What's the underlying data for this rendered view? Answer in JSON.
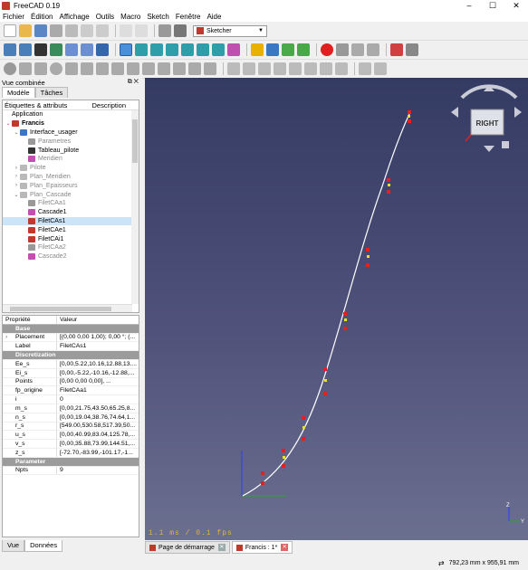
{
  "window": {
    "title": "FreeCAD 0.19",
    "controls": [
      "–",
      "☐",
      "✕"
    ]
  },
  "menu": [
    "Fichier",
    "Édition",
    "Affichage",
    "Outils",
    "Macro",
    "Sketch",
    "Fenêtre",
    "Aide"
  ],
  "toolbar": {
    "workbench": "Sketcher"
  },
  "combo": {
    "title": "Vue combinée",
    "tabs": [
      "Modèle",
      "Tâches"
    ],
    "tree_headers": [
      "Étiquettes & attributs",
      "Description"
    ],
    "tree": [
      {
        "label": "Application",
        "indent": 0,
        "arrow": "",
        "color": "",
        "gray": false,
        "sel": false
      },
      {
        "label": "Francis",
        "indent": 0,
        "arrow": "⌄",
        "color": "#c0392b",
        "gray": false,
        "sel": false,
        "bold": true
      },
      {
        "label": "Interface_usager",
        "indent": 1,
        "arrow": "⌄",
        "color": "#3b78c4",
        "gray": false,
        "sel": false
      },
      {
        "label": "Parametres",
        "indent": 2,
        "arrow": "",
        "color": "#999",
        "gray": true,
        "sel": false
      },
      {
        "label": "Tableau_pilote",
        "indent": 2,
        "arrow": "",
        "color": "#333",
        "gray": false,
        "sel": false
      },
      {
        "label": "Meridien",
        "indent": 2,
        "arrow": "",
        "color": "#c44fb0",
        "gray": true,
        "sel": false
      },
      {
        "label": "Pilote",
        "indent": 1,
        "arrow": "›",
        "color": "#b9b9b9",
        "gray": true,
        "sel": false
      },
      {
        "label": "Plan_Meridien",
        "indent": 1,
        "arrow": "›",
        "color": "#b9b9b9",
        "gray": true,
        "sel": false
      },
      {
        "label": "Plan_Epaisseurs",
        "indent": 1,
        "arrow": "›",
        "color": "#b9b9b9",
        "gray": true,
        "sel": false
      },
      {
        "label": "Plan_Cascade",
        "indent": 1,
        "arrow": "⌄",
        "color": "#b9b9b9",
        "gray": true,
        "sel": false
      },
      {
        "label": "FiletCAa1",
        "indent": 2,
        "arrow": "",
        "color": "#999",
        "gray": true,
        "sel": false
      },
      {
        "label": "Cascade1",
        "indent": 2,
        "arrow": "",
        "color": "#c44fb0",
        "gray": false,
        "sel": false
      },
      {
        "label": "FiletCAs1",
        "indent": 2,
        "arrow": "",
        "color": "#c0392b",
        "gray": false,
        "sel": true
      },
      {
        "label": "FiletCAe1",
        "indent": 2,
        "arrow": "",
        "color": "#c0392b",
        "gray": false,
        "sel": false
      },
      {
        "label": "FiletCAi1",
        "indent": 2,
        "arrow": "",
        "color": "#c0392b",
        "gray": false,
        "sel": false
      },
      {
        "label": "FiletCAa2",
        "indent": 2,
        "arrow": "",
        "color": "#999",
        "gray": true,
        "sel": false
      },
      {
        "label": "Cascade2",
        "indent": 2,
        "arrow": "",
        "color": "#c44fb0",
        "gray": true,
        "sel": false
      }
    ],
    "props_headers": [
      "Propriété",
      "Valeur"
    ],
    "props": [
      {
        "type": "group",
        "k": "Base",
        "v": ""
      },
      {
        "type": "row",
        "k": "Placement",
        "v": "[(0,00 0,00 1,00); 0,00 °; (...",
        "arrow": true
      },
      {
        "type": "row",
        "k": "Label",
        "v": "FiletCAs1"
      },
      {
        "type": "group",
        "k": "Discretization",
        "v": ""
      },
      {
        "type": "row",
        "k": "Ee_s",
        "v": "[0,00,5.22,10.16,12.88,13...."
      },
      {
        "type": "row",
        "k": "Ei_s",
        "v": "[0,00,-5.22,-10.16,-12.88,..."
      },
      {
        "type": "row",
        "k": "Points",
        "v": "[0,00 0,00 0,00], ..."
      },
      {
        "type": "row",
        "k": "fp_origine",
        "v": "FiletCAa1"
      },
      {
        "type": "row",
        "k": "i",
        "v": "0"
      },
      {
        "type": "row",
        "k": "m_s",
        "v": "[0,00,21.75,43.50,65.25,8..."
      },
      {
        "type": "row",
        "k": "n_s",
        "v": "[0,00,19.04,38.76,74.64,1..."
      },
      {
        "type": "row",
        "k": "r_s",
        "v": "[549.00,530.58,517.39,50..."
      },
      {
        "type": "row",
        "k": "u_s",
        "v": "[0,00,40.99,83.04,125.78,..."
      },
      {
        "type": "row",
        "k": "v_s",
        "v": "[0,00,35.88,73.99,144.51,..."
      },
      {
        "type": "row",
        "k": "z_s",
        "v": "[-72.70,-83.99,-101.17,-1..."
      },
      {
        "type": "group",
        "k": "Parameter",
        "v": ""
      },
      {
        "type": "row",
        "k": "Npts",
        "v": "9"
      }
    ],
    "bottom_tabs": [
      "Vue",
      "Données"
    ]
  },
  "viewport": {
    "fps": "1.1 ms / 0.1 fps",
    "nav_label": "RIGHT",
    "axis_z": "Z",
    "axis_y": "Y"
  },
  "doc_tabs": [
    {
      "label": "Page de démarrage",
      "active": false
    },
    {
      "label": "Francis : 1*",
      "active": true
    }
  ],
  "status": {
    "dimensions": "792,23 mm x 955,91 mm"
  }
}
